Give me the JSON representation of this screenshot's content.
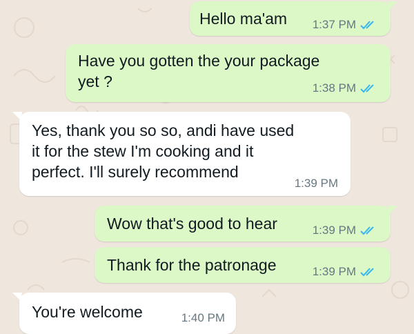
{
  "theme": {
    "background": "#efe7de",
    "outgoing_bubble": "#dcf8c6",
    "incoming_bubble": "#ffffff",
    "read_tick_color": "#34b7f1",
    "time_color": "#667781"
  },
  "messages": [
    {
      "direction": "outgoing",
      "text": "Hello ma'am",
      "time": "1:37 PM",
      "status": "read",
      "status_icon": "double-check-icon"
    },
    {
      "direction": "outgoing",
      "text": "Have you gotten the your package\nyet ?",
      "time": "1:38 PM",
      "status": "read",
      "status_icon": "double-check-icon"
    },
    {
      "direction": "incoming",
      "text": "Yes, thank you so so, andi have used\nit for the stew I'm cooking and it\nperfect. I'll surely recommend",
      "time": "1:39 PM"
    },
    {
      "direction": "outgoing",
      "text": "Wow that's good to hear",
      "time": "1:39 PM",
      "status": "read",
      "status_icon": "double-check-icon"
    },
    {
      "direction": "outgoing",
      "text": "Thank for the patronage",
      "time": "1:39 PM",
      "status": "read",
      "status_icon": "double-check-icon"
    },
    {
      "direction": "incoming",
      "text": "You're welcome",
      "time": "1:40 PM"
    }
  ]
}
